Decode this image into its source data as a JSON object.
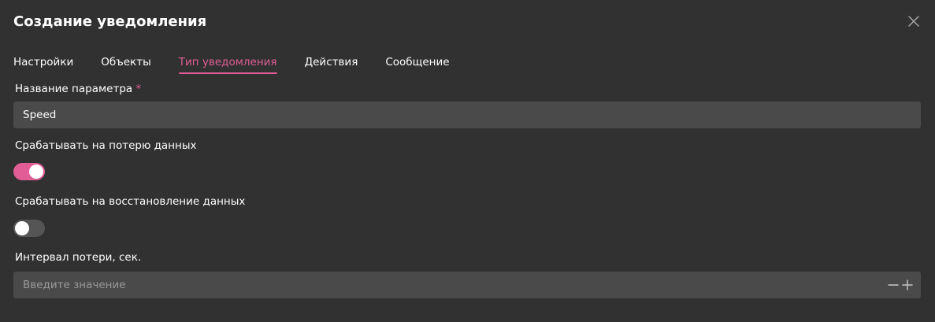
{
  "dialog": {
    "title": "Создание уведомления"
  },
  "tabs": [
    {
      "label": "Настройки",
      "active": false
    },
    {
      "label": "Объекты",
      "active": false
    },
    {
      "label": "Тип уведомления",
      "active": true
    },
    {
      "label": "Действия",
      "active": false
    },
    {
      "label": "Сообщение",
      "active": false
    }
  ],
  "form": {
    "param_name": {
      "label": "Название параметра",
      "required_mark": "*",
      "value": "Speed"
    },
    "on_data_loss": {
      "label": "Срабатывать на потерю данных",
      "enabled": true
    },
    "on_data_restore": {
      "label": "Срабатывать на восстановление данных",
      "enabled": false
    },
    "loss_interval": {
      "label": "Интервал потери, сек.",
      "value": "",
      "placeholder": "Введите значение"
    }
  },
  "colors": {
    "accent": "#e25d95",
    "background": "#313131",
    "field": "#4a4a4a"
  },
  "icons": {
    "close": "close-icon",
    "minus": "minus-icon",
    "plus": "plus-icon"
  }
}
